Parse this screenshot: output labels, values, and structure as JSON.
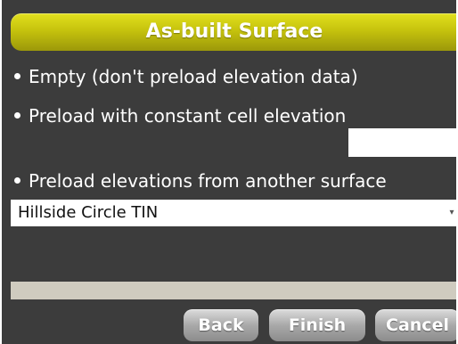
{
  "dialog": {
    "title": "As-built Surface"
  },
  "options": {
    "empty_label": "Empty (don't preload elevation data)",
    "constant_label": "Preload with constant cell elevation",
    "surface_label": "Preload elevations from another surface"
  },
  "elevation_input": {
    "value": ""
  },
  "surface_select": {
    "selected": "Hillside Circle TIN"
  },
  "buttons": {
    "back": "Back",
    "finish": "Finish",
    "cancel": "Cancel"
  },
  "colors": {
    "title_bar": "#c6c30d",
    "background": "#3c3c3c",
    "button": "#a9a9a9"
  }
}
